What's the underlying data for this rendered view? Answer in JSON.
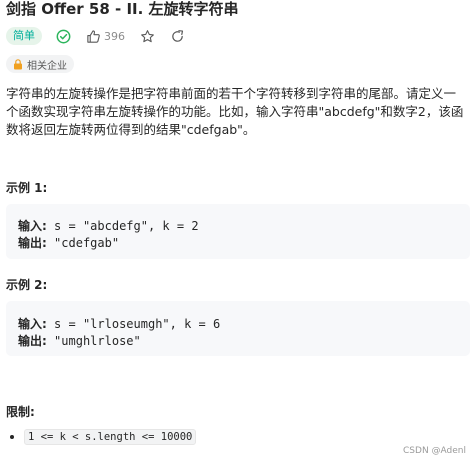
{
  "problem": {
    "title": "剑指 Offer 58 - II. 左旋转字符串",
    "difficulty": "简单",
    "likes": "396",
    "company_tag": "相关企业",
    "description": "字符串的左旋转操作是把字符串前面的若干个字符转移到字符串的尾部。请定义一个函数实现字符串左旋转操作的功能。比如，输入字符串\"abcdefg\"和数字2，该函数将返回左旋转两位得到的结果\"cdefgab\"。"
  },
  "examples": [
    {
      "heading": "示例 1:",
      "input_label": "输入:",
      "input_value": "s = \"abcdefg\", k = 2",
      "output_label": "输出:",
      "output_value": "\"cdefgab\""
    },
    {
      "heading": "示例 2:",
      "input_label": "输入:",
      "input_value": "s = \"lrloseumgh\", k = 6",
      "output_label": "输出:",
      "output_value": "\"umghlrlose\""
    }
  ],
  "constraints": {
    "heading": "限制:",
    "items": [
      "1 <= k < s.length <= 10000"
    ]
  },
  "watermark": "CSDN @Adenl",
  "icons": {
    "solved": "check-circle-icon",
    "like": "thumbs-up-icon",
    "star": "star-icon",
    "share": "share-icon",
    "lock": "lock-icon"
  },
  "colors": {
    "easy": "#00af9b",
    "easy_bg": "#e6f4ea",
    "example_bg": "#f7f8fa"
  }
}
